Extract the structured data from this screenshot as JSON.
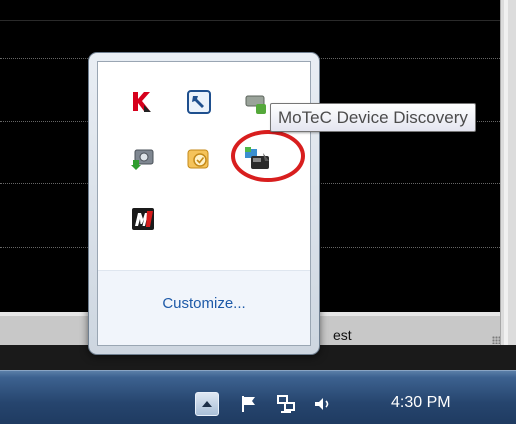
{
  "tray_overflow": {
    "customize_label": "Customize...",
    "tooltip_text": "MoTeC Device Discovery",
    "icons": [
      {
        "name": "kaspersky-icon"
      },
      {
        "name": "remote-tool-icon"
      },
      {
        "name": "network-device-icon"
      },
      {
        "name": "camera-download-icon"
      },
      {
        "name": "outlook-icon"
      },
      {
        "name": "motec-device-discovery-icon"
      },
      {
        "name": "motec-m-icon"
      }
    ]
  },
  "background": {
    "partial_label": "est"
  },
  "taskbar": {
    "clock_time": "4:30 PM",
    "tray_icons": [
      "show-hidden-icons-button",
      "action-center-flag-icon",
      "network-icon",
      "volume-icon"
    ]
  },
  "colors": {
    "highlight_circle": "#d81e1e",
    "link": "#1e5aa8"
  }
}
